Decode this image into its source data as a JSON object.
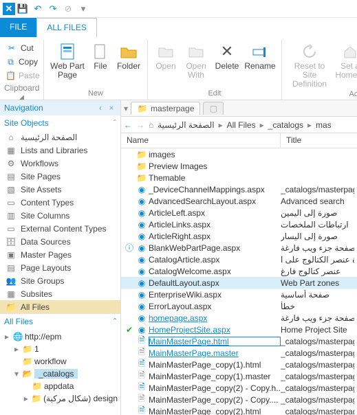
{
  "qat": {
    "items": [
      "app",
      "save",
      "undo",
      "redo",
      "stop",
      "menu"
    ]
  },
  "tabs": {
    "file": "FILE",
    "all": "ALL FILES"
  },
  "ribbon": {
    "clipboard": {
      "label": "Clipboard",
      "cut": "Cut",
      "copy": "Copy",
      "paste": "Paste"
    },
    "new": {
      "label": "New",
      "webpart": "Web Part\nPage",
      "file": "File",
      "folder": "Folder"
    },
    "edit": {
      "label": "Edit",
      "open": "Open",
      "openwith": "Open\nWith",
      "delete": "Delete",
      "rename": "Rename"
    },
    "actions": {
      "label": "Actio",
      "reset": "Reset to Site\nDefinition",
      "setas": "Set a\nHome P"
    }
  },
  "nav": {
    "title": "Navigation",
    "siteobjects": "Site Objects",
    "allfiles": "All Files",
    "items": [
      {
        "k": "home",
        "t": "الصفحة الرئيسية"
      },
      {
        "k": "lists",
        "t": "Lists and Libraries"
      },
      {
        "k": "wf",
        "t": "Workflows"
      },
      {
        "k": "sp",
        "t": "Site Pages"
      },
      {
        "k": "sa",
        "t": "Site Assets"
      },
      {
        "k": "ct",
        "t": "Content Types"
      },
      {
        "k": "sc",
        "t": "Site Columns"
      },
      {
        "k": "ect",
        "t": "External Content Types"
      },
      {
        "k": "ds",
        "t": "Data Sources"
      },
      {
        "k": "mp",
        "t": "Master Pages"
      },
      {
        "k": "pl",
        "t": "Page Layouts"
      },
      {
        "k": "sg",
        "t": "Site Groups"
      },
      {
        "k": "ss",
        "t": "Subsites"
      },
      {
        "k": "af",
        "t": "All Files"
      }
    ],
    "tree": {
      "root": "http://epm",
      "n1": "1",
      "wf": "workflow",
      "cat": "_catalogs",
      "app": "appdata",
      "design": "(شكال مركبة) design"
    }
  },
  "path": {
    "tab": "masterpage",
    "crumbs": [
      "الصفحة الرئيسية",
      "All Files",
      "_catalogs",
      "mas"
    ]
  },
  "cols": {
    "name": "Name",
    "title": "Title"
  },
  "files": [
    {
      "ic": "folder",
      "n": "images",
      "t": ""
    },
    {
      "ic": "folder",
      "n": "Preview Images",
      "t": ""
    },
    {
      "ic": "folder",
      "n": "Themable",
      "t": ""
    },
    {
      "ic": "aspx",
      "n": "_DeviceChannelMappings.aspx",
      "t": "_catalogs/masterpag"
    },
    {
      "ic": "aspx",
      "n": "AdvancedSearchLayout.aspx",
      "t": "Advanced search"
    },
    {
      "ic": "aspx",
      "n": "ArticleLeft.aspx",
      "t": "صورة إلى اليمين"
    },
    {
      "ic": "aspx",
      "n": "ArticleLinks.aspx",
      "t": "ارتباطات الملخصات"
    },
    {
      "ic": "aspx",
      "n": "ArticleRight.aspx",
      "t": "صورة إلى اليسار"
    },
    {
      "ic": "aspx",
      "n": "BlankWebPartPage.aspx",
      "t": "صفحة جزء ويب فارغة",
      "mk": "info"
    },
    {
      "ic": "aspx",
      "n": "CatalogArticle.aspx",
      "t": "صورة عنصر الكتالوج على ا"
    },
    {
      "ic": "aspx",
      "n": "CatalogWelcome.aspx",
      "t": "عنصر كتالوج فارغ"
    },
    {
      "ic": "aspx",
      "n": "DefaultLayout.aspx",
      "t": "Web Part zones",
      "sel": true
    },
    {
      "ic": "aspx",
      "n": "EnterpriseWiki.aspx",
      "t": "صفحة أساسية"
    },
    {
      "ic": "aspx",
      "n": "ErrorLayout.aspx",
      "t": "خطأ"
    },
    {
      "ic": "aspx",
      "n": "homepage.aspx",
      "t": "صفحة جزء ويب فارغة",
      "link": true
    },
    {
      "ic": "aspx",
      "n": "HomeProjectSite.aspx",
      "t": "Home Project Site",
      "mk": "check",
      "link": true
    },
    {
      "ic": "html",
      "n": "MainMasterPage.html",
      "t": "_catalogs/masterpag",
      "link": true,
      "hi": true
    },
    {
      "ic": "master",
      "n": "MainMasterPage.master",
      "t": "_catalogs/masterpag",
      "link": true
    },
    {
      "ic": "html",
      "n": "MainMasterPage_copy(1).html",
      "t": "_catalogs/masterpag"
    },
    {
      "ic": "master",
      "n": "MainMasterPage_copy(1).master",
      "t": "_catalogs/masterpag"
    },
    {
      "ic": "html",
      "n": "MainMasterPage_copy(2) - Copy.h...",
      "t": "_catalogs/masterpag"
    },
    {
      "ic": "master",
      "n": "MainMasterPage_copy(2) - Copy....",
      "t": "_catalogs/masterpag"
    },
    {
      "ic": "html",
      "n": "MainMasterPage_copy(2).html",
      "t": "_catalogs/masterpag"
    }
  ]
}
